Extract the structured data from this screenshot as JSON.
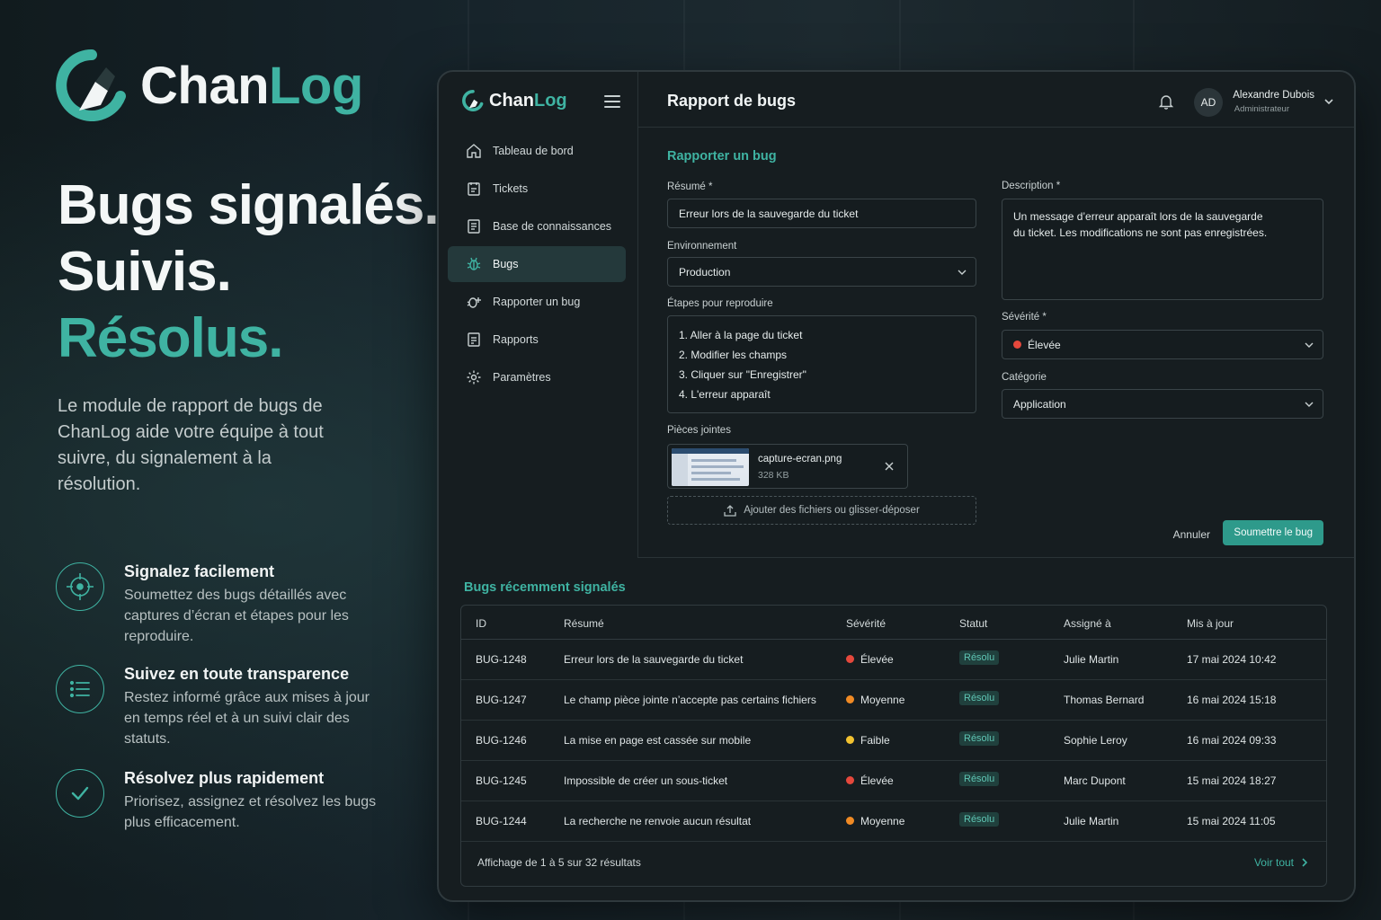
{
  "brand": {
    "chan": "Chan",
    "log": "Log"
  },
  "hero": {
    "line1": "Bugs signalés.",
    "line2": "Suivis.",
    "line3": "Résolus."
  },
  "lead": "Le module de rapport de bugs de ChanLog aide votre équipe à tout suivre, du signalement à la résolution.",
  "features": [
    {
      "icon": "crosshair-icon",
      "title": "Signalez facilement",
      "desc": "Soumettez des bugs détaillés avec captures d’écran et étapes pour les reproduire."
    },
    {
      "icon": "list-icon",
      "title": "Suivez en toute transparence",
      "desc": "Restez informé grâce aux mises à jour en temps réel et à un suivi clair des statuts."
    },
    {
      "icon": "check-icon",
      "title": "Résolvez plus rapidement",
      "desc": "Priorisez, assignez et résolvez les bugs plus efficacement."
    }
  ],
  "sidebar": {
    "items": [
      {
        "label": "Tableau de bord",
        "icon": "home-icon"
      },
      {
        "label": "Tickets",
        "icon": "ticket-icon"
      },
      {
        "label": "Base de connaissances",
        "icon": "book-icon"
      },
      {
        "label": "Bugs",
        "icon": "bug-icon",
        "active": true
      },
      {
        "label": "Rapporter un bug",
        "icon": "report-bug-icon"
      },
      {
        "label": "Rapports",
        "icon": "document-icon"
      },
      {
        "label": "Paramètres",
        "icon": "gear-icon"
      }
    ]
  },
  "header": {
    "title": "Rapport de bugs",
    "user": {
      "initials": "AD",
      "name": "Alexandre Dubois",
      "role": "Administrateur"
    }
  },
  "form": {
    "title": "Rapporter un bug",
    "summary_label": "Résumé *",
    "summary_value": "Erreur lors de la sauvegarde du ticket",
    "env_label": "Environnement",
    "env_value": "Production",
    "steps_label": "Étapes pour reproduire",
    "steps": [
      "1.  Aller à la page du ticket",
      "2.  Modifier les champs",
      "3.  Cliquer sur \"Enregistrer\"",
      "4.  L'erreur apparaît"
    ],
    "attach_label": "Pièces jointes",
    "attachment": {
      "name": "capture-ecran.png",
      "size": "328 KB"
    },
    "dropzone": "Ajouter des fichiers ou glisser-déposer",
    "desc_label": "Description *",
    "desc_line1": "Un message d’erreur apparaît lors de la sauvegarde",
    "desc_line2": "du ticket. Les modifications ne sont pas enregistrées.",
    "severity_label": "Sévérité *",
    "severity_value": "Élevée",
    "category_label": "Catégorie",
    "category_value": "Application",
    "cancel": "Annuler",
    "submit": "Soumettre le bug"
  },
  "recent": {
    "title": "Bugs récemment signalés",
    "columns": [
      "ID",
      "Résumé",
      "Sévérité",
      "Statut",
      "Assigné à",
      "Mis à jour"
    ],
    "rows": [
      {
        "id": "BUG-1248",
        "summary": "Erreur lors de la sauvegarde du ticket",
        "severity": "Élevée",
        "sev_color": "#e5483c",
        "status": "Résolu",
        "assignee": "Julie Martin",
        "updated": "17 mai 2024 10:42"
      },
      {
        "id": "BUG-1247",
        "summary": "Le champ pièce jointe n’accepte pas certains fichiers",
        "severity": "Moyenne",
        "sev_color": "#f08a24",
        "status": "Résolu",
        "assignee": "Thomas Bernard",
        "updated": "16 mai 2024 15:18"
      },
      {
        "id": "BUG-1246",
        "summary": "La mise en page est cassée sur mobile",
        "severity": "Faible",
        "sev_color": "#f2c230",
        "status": "Résolu",
        "assignee": "Sophie Leroy",
        "updated": "16 mai 2024 09:33"
      },
      {
        "id": "BUG-1245",
        "summary": "Impossible de créer un sous-ticket",
        "severity": "Élevée",
        "sev_color": "#e5483c",
        "status": "Résolu",
        "assignee": "Marc Dupont",
        "updated": "15 mai 2024 18:27"
      },
      {
        "id": "BUG-1244",
        "summary": "La recherche ne renvoie aucun résultat",
        "severity": "Moyenne",
        "sev_color": "#f08a24",
        "status": "Résolu",
        "assignee": "Julie Martin",
        "updated": "15 mai 2024 11:05"
      }
    ],
    "footer_count": "Affichage de 1 à 5 sur 32 résultats",
    "view_all": "Voir tout"
  },
  "colors": {
    "accent": "#3fb3a2",
    "button": "#2e9a8b",
    "high": "#e5483c",
    "medium": "#f08a24",
    "low": "#f2c230"
  }
}
